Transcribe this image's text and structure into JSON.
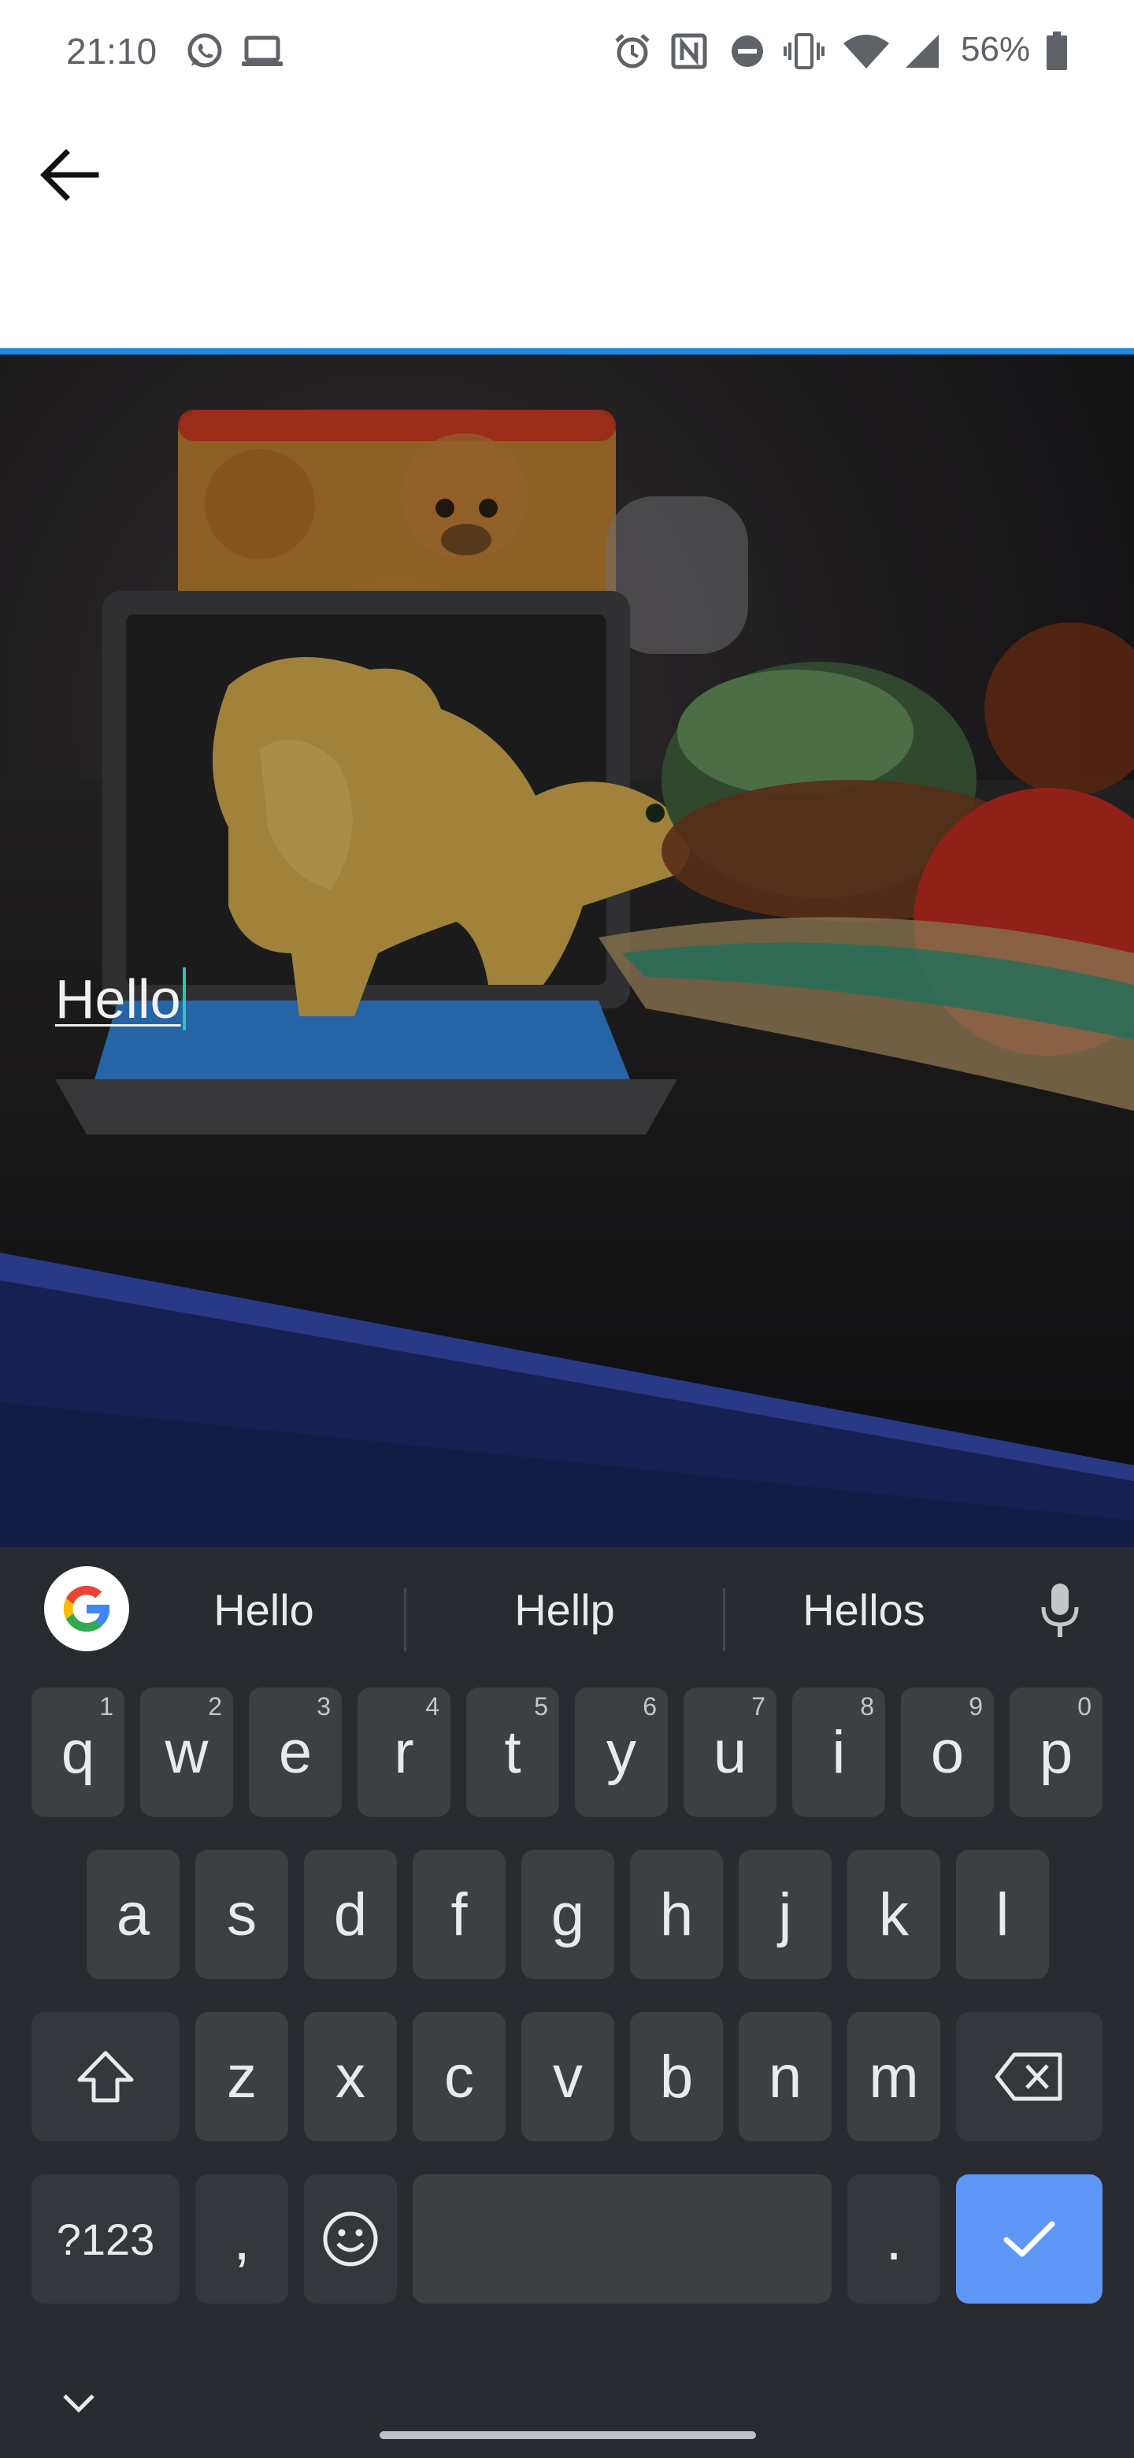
{
  "status_bar": {
    "time": "21:10",
    "battery_percent": "56%",
    "left_icons": [
      "whatsapp-icon",
      "laptop-icon"
    ],
    "right_icons": [
      "alarm-icon",
      "nfc-icon",
      "do-not-disturb-icon",
      "vibrate-icon",
      "wifi-icon",
      "signal-icon",
      "battery-icon"
    ],
    "color": "#5f6368"
  },
  "app_bar": {
    "back_icon": "arrow-left-icon",
    "accent_color": "#1e88e5"
  },
  "canvas": {
    "overlay_text": "Hello",
    "cursor_color": "#2ec4b6"
  },
  "keyboard": {
    "suggestions": [
      "Hello",
      "Hellp",
      "Hellos"
    ],
    "row1": [
      {
        "label": "q",
        "hint": "1"
      },
      {
        "label": "w",
        "hint": "2"
      },
      {
        "label": "e",
        "hint": "3"
      },
      {
        "label": "r",
        "hint": "4"
      },
      {
        "label": "t",
        "hint": "5"
      },
      {
        "label": "y",
        "hint": "6"
      },
      {
        "label": "u",
        "hint": "7"
      },
      {
        "label": "i",
        "hint": "8"
      },
      {
        "label": "o",
        "hint": "9"
      },
      {
        "label": "p",
        "hint": "0"
      }
    ],
    "row2": [
      "a",
      "s",
      "d",
      "f",
      "g",
      "h",
      "j",
      "k",
      "l"
    ],
    "row3": [
      "z",
      "x",
      "c",
      "v",
      "b",
      "n",
      "m"
    ],
    "symbols_label": "?123",
    "comma_label": ",",
    "period_label": ".",
    "enter_color": "#5e97f6",
    "background": "#282b2f"
  }
}
